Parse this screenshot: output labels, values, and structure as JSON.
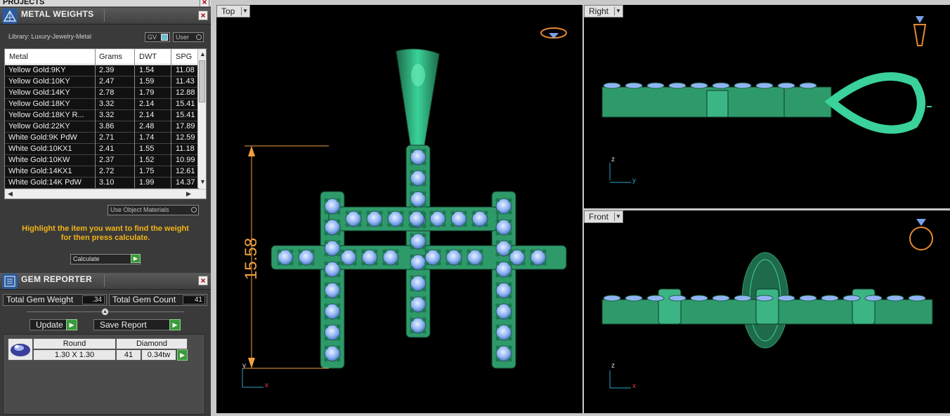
{
  "projects_label": "PROJECTS",
  "metal_weights": {
    "title": "METAL WEIGHTS",
    "library_label": "Library: Luxury-Jewelry-Metal",
    "gv_label": "GV",
    "user_label": "User",
    "columns": [
      "Metal",
      "Grams",
      "DWT",
      "SPG"
    ],
    "rows": [
      {
        "metal": "Yellow Gold:9KY",
        "grams": "2.39",
        "dwt": "1.54",
        "spg": "11.08"
      },
      {
        "metal": "Yellow Gold:10KY",
        "grams": "2.47",
        "dwt": "1.59",
        "spg": "11.43"
      },
      {
        "metal": "Yellow Gold:14KY",
        "grams": "2.78",
        "dwt": "1.79",
        "spg": "12.88"
      },
      {
        "metal": "Yellow Gold:18KY",
        "grams": "3.32",
        "dwt": "2.14",
        "spg": "15.41"
      },
      {
        "metal": "Yellow Gold:18KY R...",
        "grams": "3.32",
        "dwt": "2.14",
        "spg": "15.41"
      },
      {
        "metal": "Yellow Gold:22KY",
        "grams": "3.86",
        "dwt": "2.48",
        "spg": "17.89"
      },
      {
        "metal": "White Gold:9K PdW",
        "grams": "2.71",
        "dwt": "1.74",
        "spg": "12.59"
      },
      {
        "metal": "White Gold:10KX1",
        "grams": "2.41",
        "dwt": "1.55",
        "spg": "11.18"
      },
      {
        "metal": "White Gold:10KW",
        "grams": "2.37",
        "dwt": "1.52",
        "spg": "10.99"
      },
      {
        "metal": "White Gold:14KX1",
        "grams": "2.72",
        "dwt": "1.75",
        "spg": "12.61"
      },
      {
        "metal": "White Gold:14K PdW",
        "grams": "3.10",
        "dwt": "1.99",
        "spg": "14.37"
      }
    ],
    "use_object_materials": "Use Object Materials",
    "hint_line1": "Highlight the item you want to find the weight",
    "hint_line2": "for then press calculate.",
    "calculate_label": "Calculate"
  },
  "gem_reporter": {
    "title": "GEM REPORTER",
    "total_weight_label": "Total Gem Weight",
    "total_weight_value": ".34",
    "total_count_label": "Total Gem Count",
    "total_count_value": "41",
    "update_label": "Update",
    "save_report_label": "Save Report",
    "gem": {
      "shape": "Round",
      "material": "Diamond",
      "size": "1.30 X 1.30",
      "count": "41",
      "weight": "0.34tw"
    }
  },
  "viewports": {
    "top": {
      "label": "Top",
      "dimension": "15.58",
      "axis_y": "y",
      "axis_x": "x"
    },
    "right": {
      "label": "Right",
      "axis_z": "z",
      "axis_y": "y"
    },
    "front": {
      "label": "Front",
      "axis_z": "z",
      "axis_x": "x"
    }
  },
  "colors": {
    "metal_green": "#2e9a6a",
    "gem_blue": "#8fb4f2",
    "dimension_orange": "#f0a040",
    "hint_yellow": "#f2b418"
  }
}
